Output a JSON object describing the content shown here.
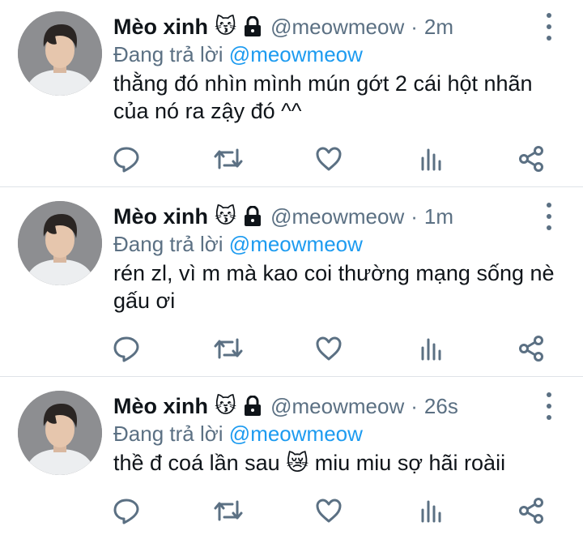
{
  "colors": {
    "accent": "#1d9bf0",
    "secondary": "#5b7083",
    "text": "#0f1419",
    "divider": "#dfe3e8"
  },
  "icons": {
    "more": "more-vertical-icon",
    "reply": "reply-icon",
    "retweet": "retweet-icon",
    "like": "like-icon",
    "analytics": "analytics-icon",
    "share": "share-icon",
    "lock": "lock-icon"
  },
  "tweets": [
    {
      "name": "Mèo xinh",
      "emoji": "😽",
      "handle": "@meowmeow",
      "separator": "·",
      "time": "2m",
      "reply_prefix": "Đang trả lời",
      "reply_to": "@meowmeow",
      "text": "thằng đó nhìn mình mún gớt 2 cái hột nhãn của nó ra zậy đó ^^"
    },
    {
      "name": "Mèo xinh",
      "emoji": "😽",
      "handle": "@meowmeow",
      "separator": "·",
      "time": "1m",
      "reply_prefix": "Đang trả lời",
      "reply_to": "@meowmeow",
      "text": "rén zl, vì m mà kao coi thường mạng sống nè gấu ơi"
    },
    {
      "name": "Mèo xinh",
      "emoji": "😽",
      "handle": "@meowmeow",
      "separator": "·",
      "time": "26s",
      "reply_prefix": "Đang trả lời",
      "reply_to": "@meowmeow",
      "text": "thề đ coá lần sau 😿 miu miu sợ hãi roàii"
    }
  ]
}
